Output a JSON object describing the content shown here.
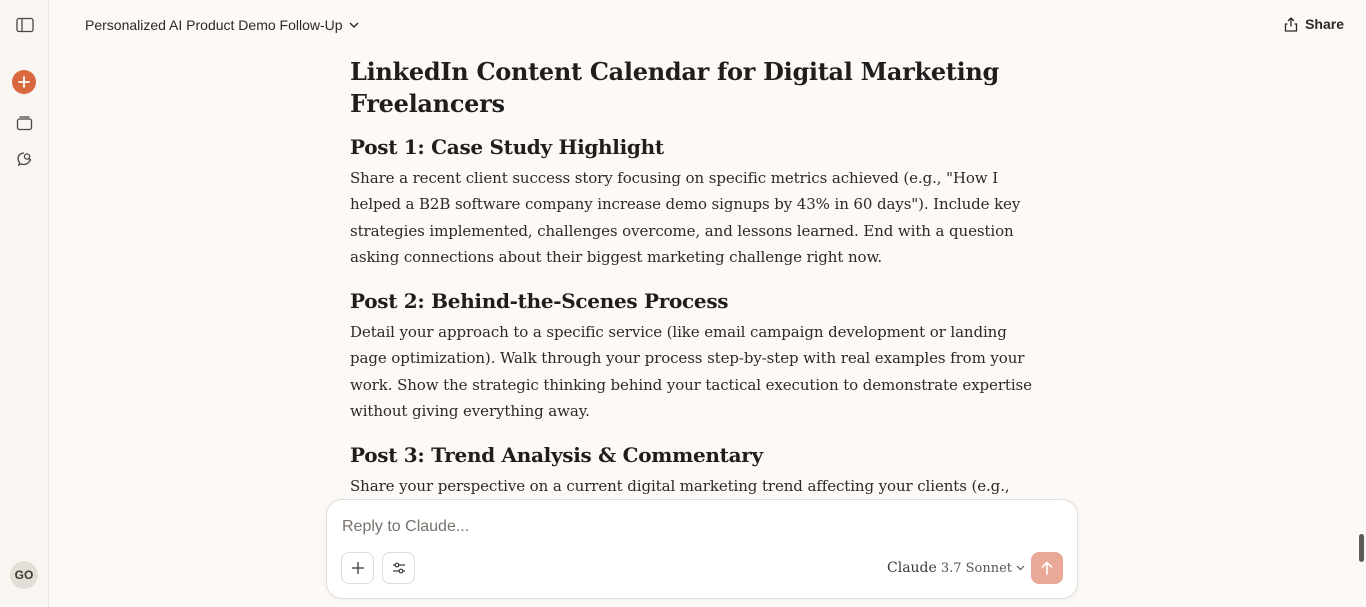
{
  "header": {
    "conversation_title": "Personalized AI Product Demo Follow-Up",
    "share_label": "Share"
  },
  "sidebar": {
    "avatar_initials": "GO"
  },
  "message": {
    "title": "LinkedIn Content Calendar for Digital Marketing Freelancers",
    "posts": [
      {
        "heading": "Post 1: Case Study Highlight",
        "body": "Share a recent client success story focusing on specific metrics achieved (e.g., \"How I helped a B2B software company increase demo signups by 43% in 60 days\"). Include key strategies implemented, challenges overcome, and lessons learned. End with a question asking connections about their biggest marketing challenge right now."
      },
      {
        "heading": "Post 2: Behind-the-Scenes Process",
        "body": "Detail your approach to a specific service (like email campaign development or landing page optimization). Walk through your process step-by-step with real examples from your work. Show the strategic thinking behind your tactical execution to demonstrate expertise without giving everything away."
      },
      {
        "heading": "Post 3: Trend Analysis & Commentary",
        "body": "Share your perspective on a current digital marketing trend affecting your clients (e.g., \"Why"
      }
    ]
  },
  "composer": {
    "placeholder": "Reply to Claude...",
    "model_name": "Claude",
    "model_version": "3.7 Sonnet"
  },
  "colors": {
    "accent": "#d9683e",
    "send_button": "#eaa996",
    "background": "#fcf9f7"
  },
  "icons": {
    "sidebar_toggle": "sidebar-toggle-icon",
    "new_chat": "plus-icon",
    "chats": "chats-icon",
    "search": "search-chat-icon",
    "dropdown": "chevron-down-icon",
    "share": "share-icon",
    "attach": "plus-icon",
    "tools": "sliders-icon",
    "send": "arrow-up-icon"
  }
}
